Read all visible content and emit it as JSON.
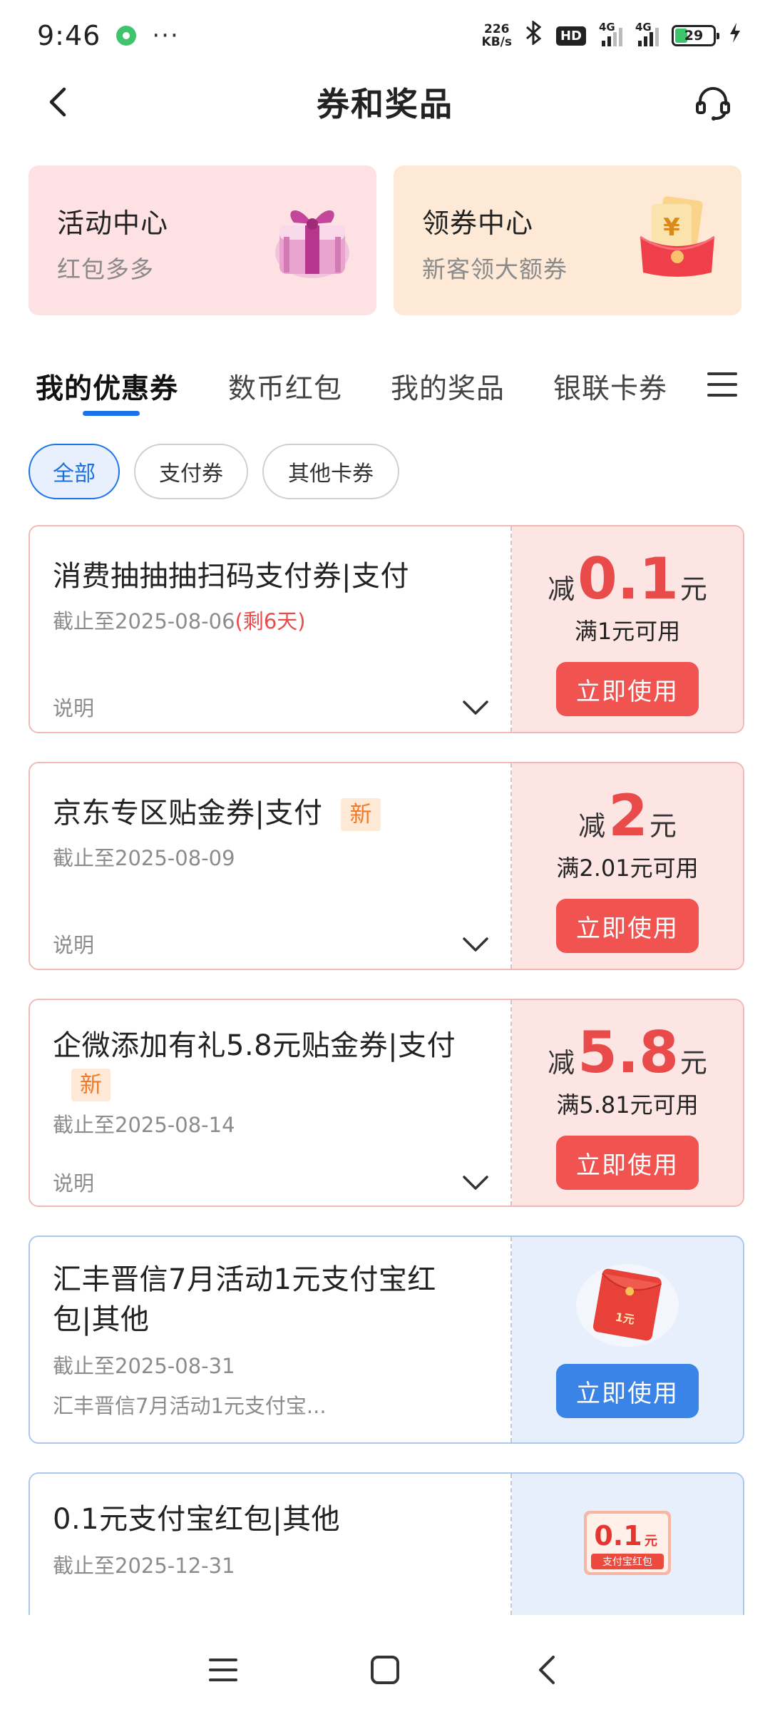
{
  "status_bar": {
    "time": "9:46",
    "more": "···",
    "net_speed_value": "226",
    "net_speed_unit": "KB/s",
    "hd_label": "HD",
    "signal_1_label": "4G",
    "signal_2_label": "4G",
    "battery_level": "29"
  },
  "nav": {
    "title": "券和奖品"
  },
  "promo": [
    {
      "title": "活动中心",
      "subtitle": "红包多多",
      "icon": "gift-box-icon"
    },
    {
      "title": "领券中心",
      "subtitle": "新客领大额券",
      "icon": "red-envelope-yuan-icon"
    }
  ],
  "tabs": [
    "我的优惠券",
    "数币红包",
    "我的奖品",
    "银联卡券"
  ],
  "active_tab": "我的优惠券",
  "filters": [
    "全部",
    "支付券",
    "其他卡券"
  ],
  "active_filter": "全部",
  "coupons": [
    {
      "title": "消费抽抽抽扫码支付券|支付",
      "date": "截止至2025-08-06",
      "remain": "(剩6天)",
      "desc": "说明",
      "prefix": "减",
      "amount": "0.1",
      "unit": "元",
      "condition": "满1元可用",
      "button": "立即使用"
    },
    {
      "title": "京东专区贴金券|支付",
      "badge": "新",
      "date": "截止至2025-08-09",
      "desc": "说明",
      "prefix": "减",
      "amount": "2",
      "unit": "元",
      "condition": "满2.01元可用",
      "button": "立即使用"
    },
    {
      "title": "企微添加有礼5.8元贴金券|支付",
      "badge": "新",
      "date": "截止至2025-08-14",
      "desc": "说明",
      "prefix": "减",
      "amount": "5.8",
      "unit": "元",
      "condition": "满5.81元可用",
      "button": "立即使用"
    },
    {
      "title_line1": "汇丰晋信7月活动1元支付宝红",
      "title_line2": "包|其他",
      "date": "截止至2025-08-31",
      "desc": "汇丰晋信7月活动1元支付宝...",
      "envelope_label": "1元",
      "button": "立即使用"
    },
    {
      "title": "0.1元支付宝红包|其他",
      "date": "截止至2025-12-31",
      "ticket_amount": "0.1",
      "ticket_unit": "元",
      "ticket_label": "支付宝红包"
    }
  ],
  "colors": {
    "accent_blue": "#1a73e8",
    "coupon_red": "#e94b4b",
    "button_red": "#f15450",
    "button_blue": "#3a84e8"
  },
  "bottom_nav": [
    "menu-icon",
    "home-square-icon",
    "back-icon"
  ]
}
